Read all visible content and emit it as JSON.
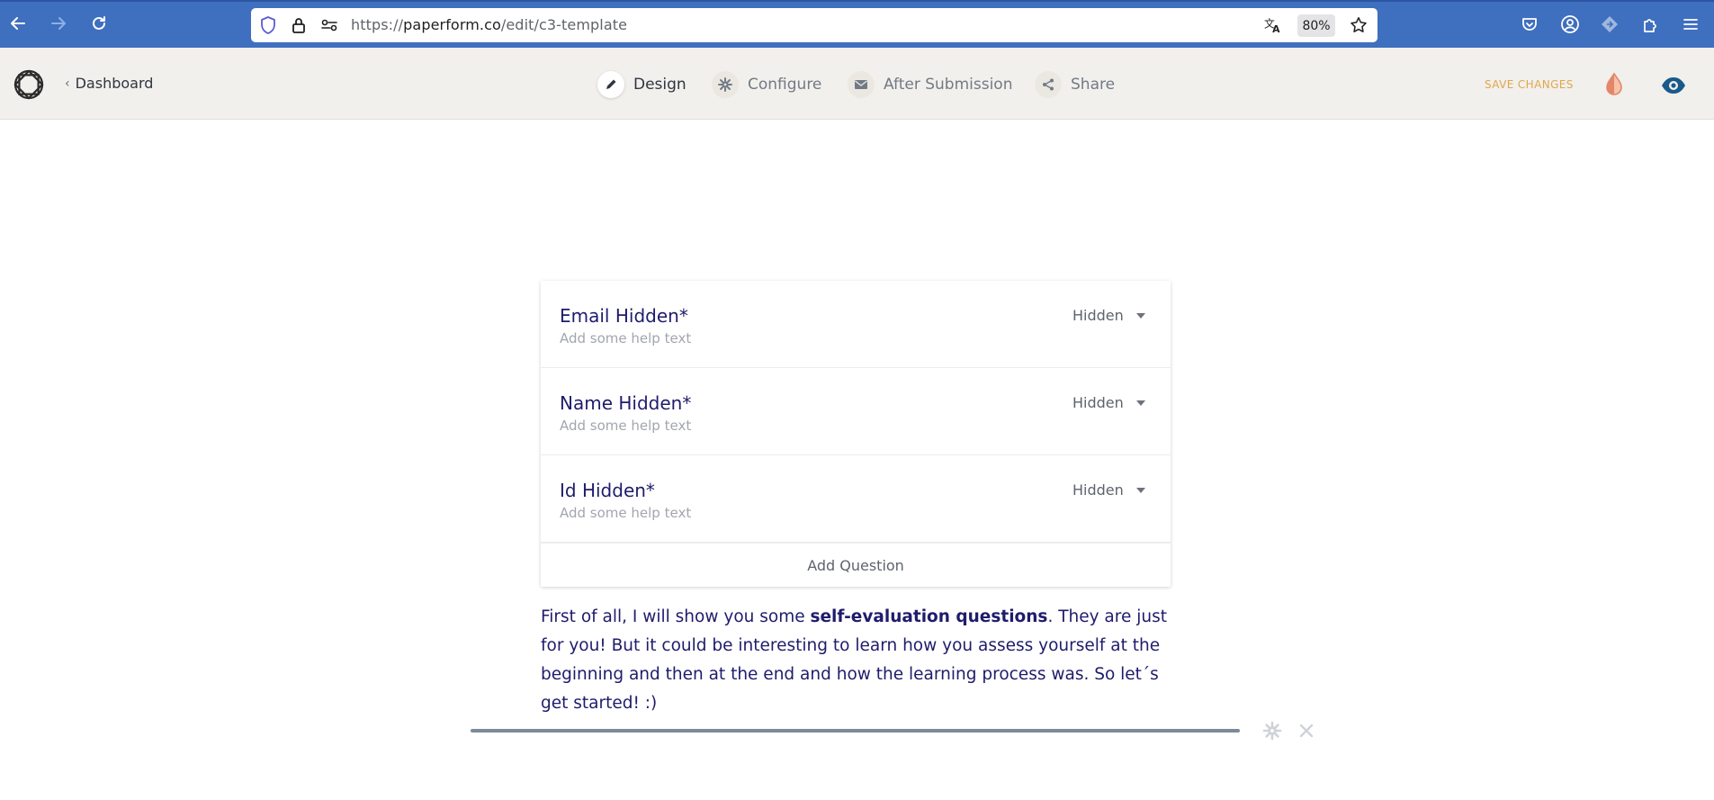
{
  "browser": {
    "url_prefix": "https://",
    "url_host": "paperform.co",
    "url_path": "/edit/c3-template",
    "zoom": "80%"
  },
  "header": {
    "back_label": "Dashboard",
    "tabs": [
      {
        "label": "Design",
        "icon": "pencil-icon",
        "active": true
      },
      {
        "label": "Configure",
        "icon": "gear-icon",
        "active": false
      },
      {
        "label": "After Submission",
        "icon": "mail-icon",
        "active": false
      },
      {
        "label": "Share",
        "icon": "share-icon",
        "active": false
      }
    ],
    "save_label": "SAVE CHANGES"
  },
  "questions": [
    {
      "title": "Email Hidden*",
      "help": "Add some help text",
      "visibility": "Hidden"
    },
    {
      "title": "Name Hidden*",
      "help": "Add some help text",
      "visibility": "Hidden"
    },
    {
      "title": "Id Hidden*",
      "help": "Add some help text",
      "visibility": "Hidden"
    }
  ],
  "add_question_label": "Add Question",
  "intro": {
    "before": "First of all, I will show you some ",
    "bold": "self-evaluation questions",
    "after": ". They are just for you! But it could be interesting to learn how you assess yourself at the beginning and then at the end and how the learning process was. So let´s get started! :)"
  },
  "colors": {
    "browser_bar": "#3f6fbf",
    "header_bg": "#f2f0ec",
    "question_title": "#1f1c6b",
    "save_changes": "#e0a64e",
    "eye_icon": "#1a5a8a"
  }
}
